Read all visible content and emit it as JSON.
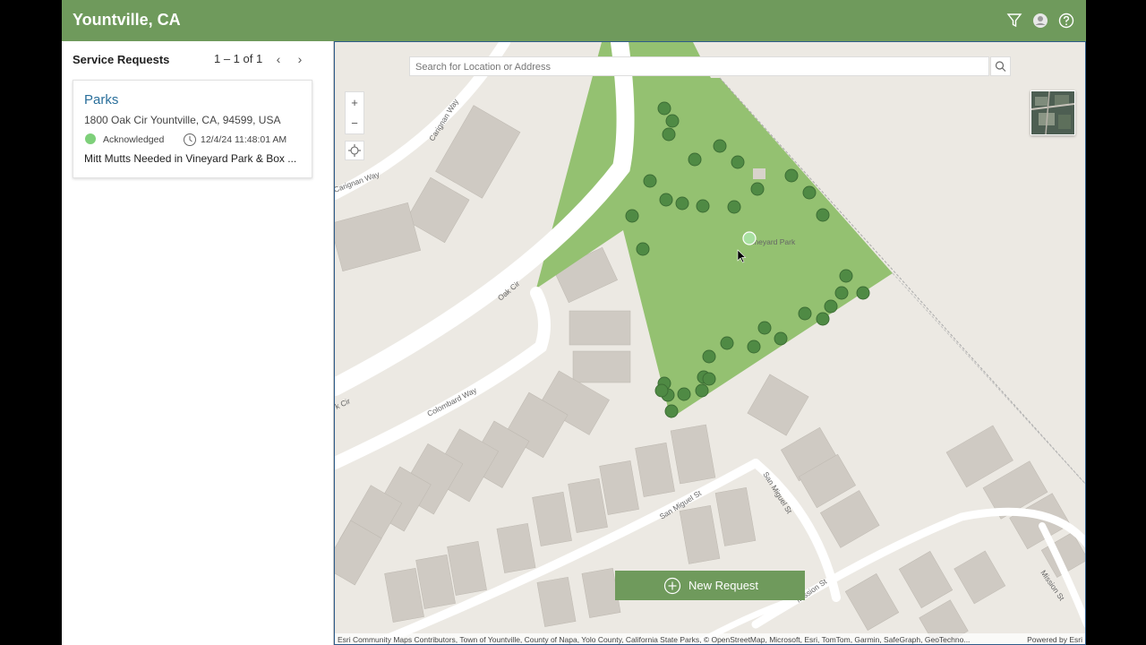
{
  "app": {
    "title": "Yountville, CA",
    "accent": "#6f9a5c"
  },
  "topbar_icons": [
    "filter-icon",
    "user-avatar-icon",
    "help-icon"
  ],
  "panel": {
    "title": "Service Requests",
    "pager": "1 – 1 of 1",
    "prev": "‹",
    "next": "›"
  },
  "requests": [
    {
      "category": "Parks",
      "address": "1800 Oak Cir Yountville, CA, 94599, USA",
      "status": "Acknowledged",
      "status_color": "#7ed07a",
      "datetime": "12/4/24 11:48:01 AM",
      "description": "Mitt Mutts Needed in Vineyard Park & Box ..."
    }
  ],
  "map": {
    "search_placeholder": "Search for Location or Address",
    "zoom_in": "+",
    "zoom_out": "−",
    "park_label": "Vineyard Park",
    "park_color": "#94c171",
    "streets": {
      "carignan_way_1": "Carignan Way",
      "carignan_way_2": "Carignan Way",
      "oak_cir": "Oak Cir",
      "colombard_way": "Colombard Way",
      "k_cir": "k Cir",
      "san_miguel_1": "San Miguel St",
      "san_miguel_2": "San Miguel St",
      "mission_st_1": "Mission St",
      "mission_st_2": "Mission St"
    },
    "new_request": "New Request",
    "attribution": "Esri Community Maps Contributors, Town of Yountville, County of Napa, Yolo County, California State Parks, © OpenStreetMap, Microsoft, Esri, TomTom, Garmin, SafeGraph, GeoTechno...",
    "powered_by": "Powered by Esri"
  }
}
